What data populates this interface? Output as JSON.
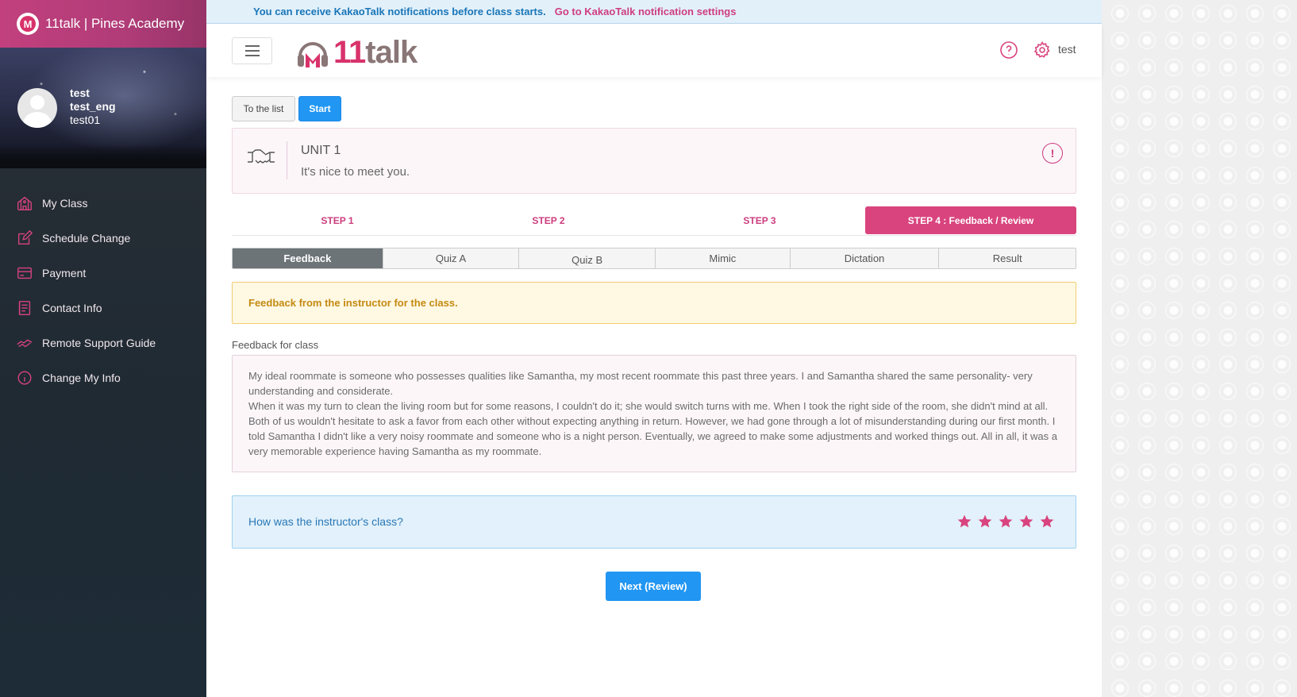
{
  "sidebar": {
    "brand": "11talk | Pines Academy",
    "brand_logo_letter": "M",
    "profile": {
      "name": "test",
      "nickname": "test_eng",
      "id": "test01"
    },
    "menu": [
      {
        "label": "My Class",
        "icon": "school-icon"
      },
      {
        "label": "Schedule Change",
        "icon": "edit-icon"
      },
      {
        "label": "Payment",
        "icon": "credit-card-icon"
      },
      {
        "label": "Contact Info",
        "icon": "book-icon"
      },
      {
        "label": "Remote Support Guide",
        "icon": "handshake-icon"
      },
      {
        "label": "Change My Info",
        "icon": "info-icon"
      }
    ]
  },
  "notice": {
    "message": "You can receive KakaoTalk notifications before class starts.",
    "link": "Go to KakaoTalk notification settings"
  },
  "header": {
    "logo_number": "11",
    "logo_word": "talk",
    "user": "test"
  },
  "actions": {
    "to_list": "To the list",
    "start": "Start"
  },
  "unit": {
    "title": "UNIT 1",
    "subtitle": "It's nice to meet you."
  },
  "steps": [
    {
      "label": "STEP 1",
      "active": false
    },
    {
      "label": "STEP 2",
      "active": false
    },
    {
      "label": "STEP 3",
      "active": false
    },
    {
      "label": "STEP 4 : Feedback / Review",
      "active": true
    }
  ],
  "subtabs": [
    {
      "label": "Feedback",
      "active": true
    },
    {
      "label": "Quiz A",
      "active": false
    },
    {
      "label": "Quiz B",
      "active": false
    },
    {
      "label": "Mimic",
      "active": false
    },
    {
      "label": "Dictation",
      "active": false
    },
    {
      "label": "Result",
      "active": false
    }
  ],
  "alert": "Feedback from the instructor for the class.",
  "feedback": {
    "label": "Feedback for class",
    "text": "My ideal roommate is someone who possesses qualities like Samantha, my most recent roommate this past three years. I and Samantha shared the same personality- very understanding and considerate.\nWhen it was my turn to clean the living room but for some reasons, I couldn't do it; she would switch turns with me. When I took the right side of the room, she didn't mind at all. Both of us wouldn't hesitate to ask a favor from each other without expecting anything in return. However, we had gone through a lot of misunderstanding during our first month. I told Samantha I didn't like a very noisy roommate and someone who is a night person. Eventually, we agreed to make some adjustments and worked things out. All in all, it was a very memorable experience having Samantha as my roommate."
  },
  "rating": {
    "question": "How was the instructor's class?",
    "stars_filled": 5,
    "stars_total": 5
  },
  "next_button": "Next (Review)",
  "colors": {
    "accent": "#d9447e",
    "primary": "#2196f3",
    "sidebar": "#1f2a33"
  }
}
